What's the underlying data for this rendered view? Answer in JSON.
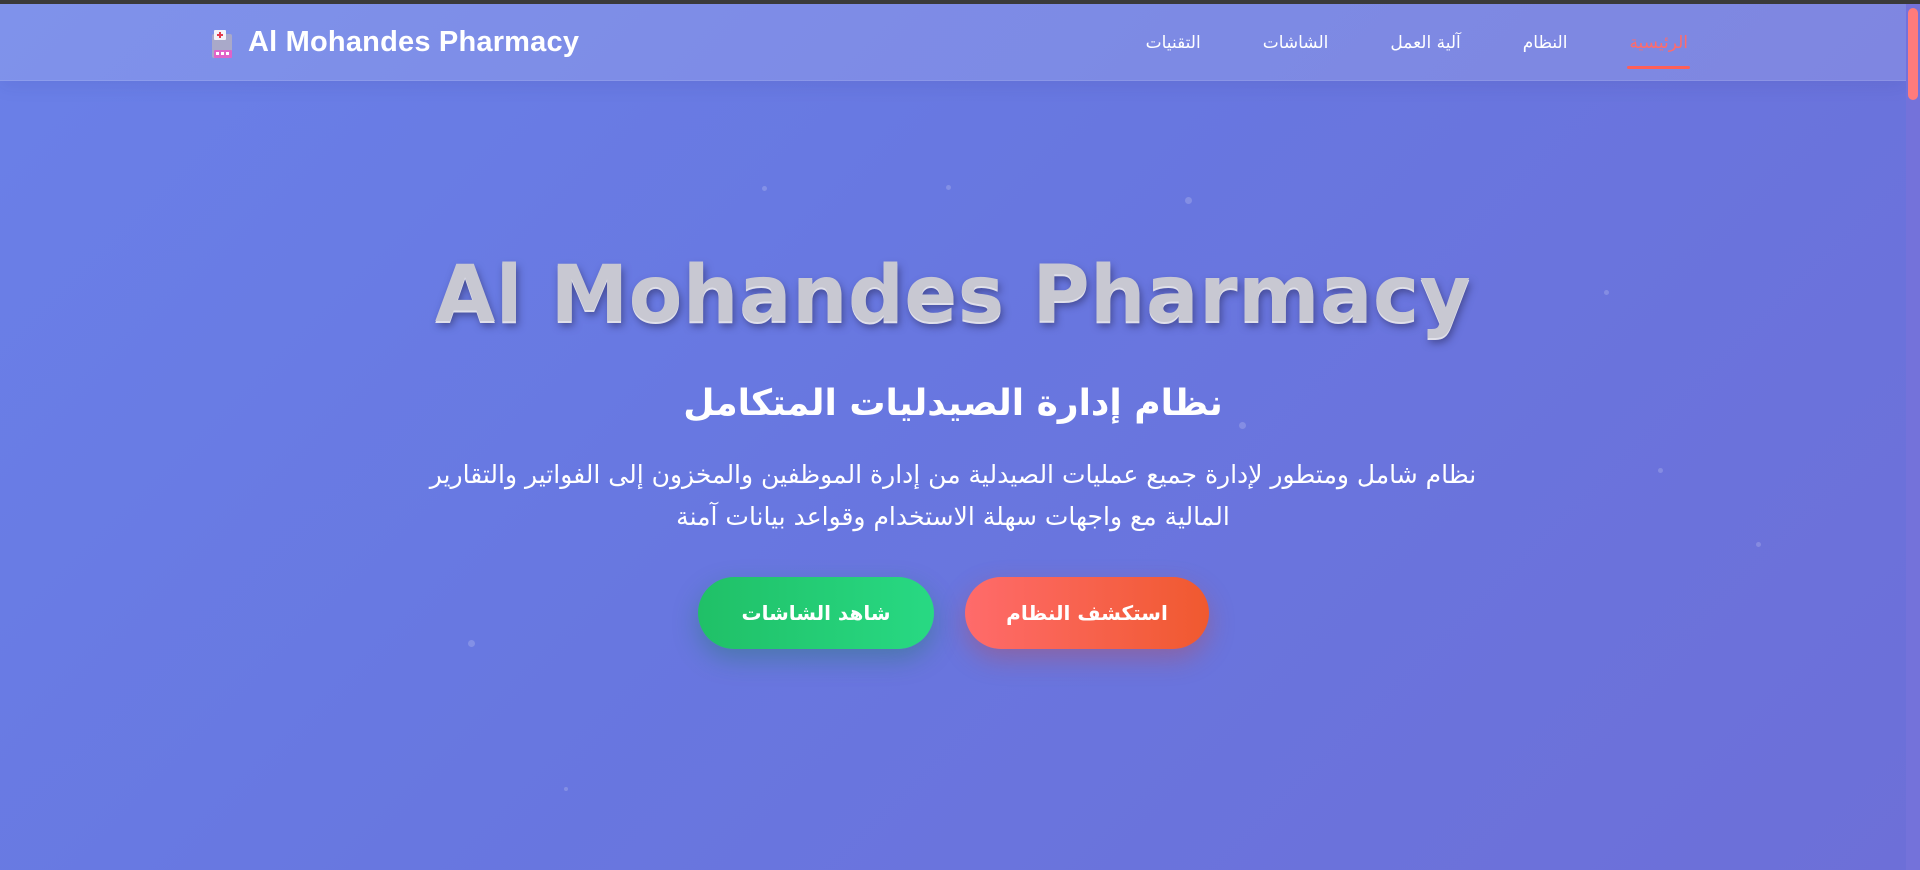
{
  "brand": {
    "name": "Al Mohandes Pharmacy",
    "icon": "pharmacy-logo-icon"
  },
  "nav": {
    "items": [
      {
        "label": "الرئيسية",
        "active": true
      },
      {
        "label": "النظام",
        "active": false
      },
      {
        "label": "آلية العمل",
        "active": false
      },
      {
        "label": "الشاشات",
        "active": false
      },
      {
        "label": "التقنيات",
        "active": false
      }
    ]
  },
  "hero": {
    "title": "Al Mohandes Pharmacy",
    "subtitle": "نظام إدارة الصيدليات المتكامل",
    "description_line1": "نظام شامل ومتطور لإدارة جميع عمليات الصيدلية من إدارة الموظفين والمخزون إلى الفواتير والتقارير",
    "description_line2": "المالية مع واجهات سهلة الاستخدام وقواعد بيانات آمنة",
    "primary_button": "استكشف النظام",
    "secondary_button": "شاهد الشاشات"
  },
  "colors": {
    "background": "#6a7ae2",
    "accent_active": "#ff6b6b",
    "button_primary": "#f0592f",
    "button_secondary": "#22c96f"
  }
}
